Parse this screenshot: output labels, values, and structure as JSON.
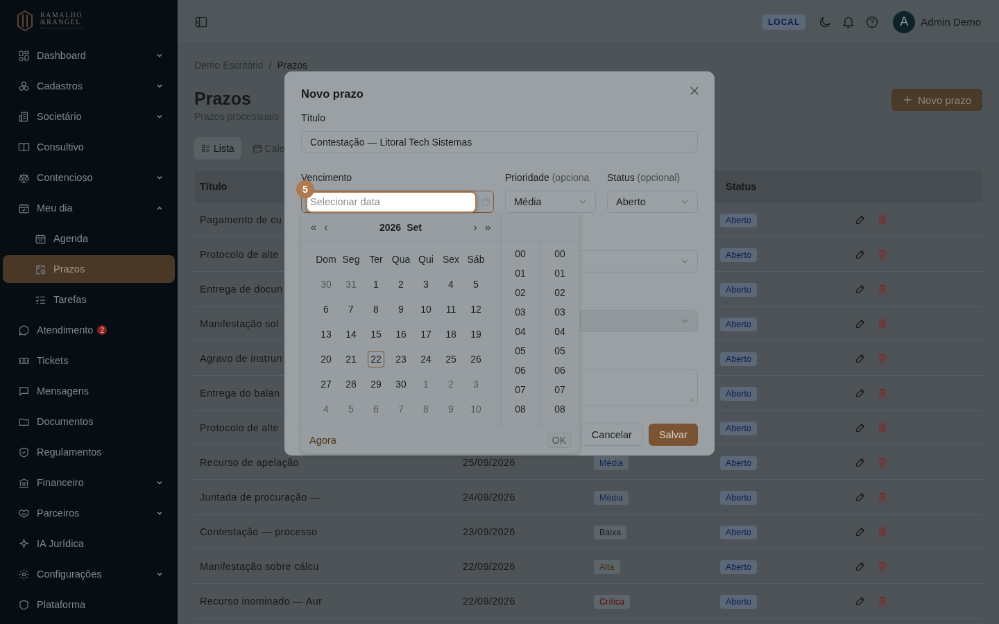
{
  "brand": {
    "line1": "RAMALHO",
    "line2": "&RANGEL"
  },
  "sidebar": {
    "items": [
      {
        "label": "Dashboard",
        "expanded": false
      },
      {
        "label": "Cadastros",
        "expanded": false
      },
      {
        "label": "Societário",
        "expanded": false
      },
      {
        "label": "Consultivo"
      },
      {
        "label": "Contencioso",
        "expanded": false
      },
      {
        "label": "Meu dia",
        "expanded": true,
        "children": [
          {
            "label": "Agenda",
            "selected": false
          },
          {
            "label": "Prazos",
            "selected": true
          },
          {
            "label": "Tarefas",
            "selected": false
          }
        ]
      },
      {
        "label": "Atendimento",
        "badge": "2"
      },
      {
        "label": "Tickets"
      },
      {
        "label": "Mensagens"
      },
      {
        "label": "Documentos"
      },
      {
        "label": "Regulamentos"
      },
      {
        "label": "Financeiro",
        "expanded": false
      },
      {
        "label": "Parceiros",
        "expanded": false
      },
      {
        "label": "IA Jurídica"
      },
      {
        "label": "Configurações",
        "expanded": false
      },
      {
        "label": "Plataforma"
      }
    ]
  },
  "topbar": {
    "environment": "LOCAL",
    "user": {
      "initial": "A",
      "name": "Admin Demo"
    }
  },
  "breadcrumb": [
    "Demo Escritório",
    "Prazos"
  ],
  "breadcrumb_separator": "/",
  "page": {
    "title": "Prazos",
    "subtitle": "Prazos processuais",
    "new_button": "Novo prazo"
  },
  "view_tabs": [
    {
      "label": "Lista",
      "selected": true
    },
    {
      "label": "Cale",
      "selected": false
    }
  ],
  "table": {
    "headers": {
      "title": "Título",
      "status": "Status"
    },
    "rows": [
      {
        "title": "Pagamento de cu",
        "status": "Aberto"
      },
      {
        "title": "Protocolo de alte",
        "status": "Aberto"
      },
      {
        "title": "Entrega de docun",
        "status": "Aberto"
      },
      {
        "title": "Manifestação sol",
        "status": "Aberto"
      },
      {
        "title": "Agravo de instrun",
        "status": "Aberto"
      },
      {
        "title": "Entrega do balan",
        "status": "Aberto"
      },
      {
        "title": "Protocolo de alte",
        "status": "Aberto"
      },
      {
        "title": "Recurso de apelação",
        "due": "25/09/2026",
        "priority": {
          "label": "Média",
          "color": "#0e2456"
        },
        "status": "Aberto"
      },
      {
        "title": "Juntada de procuração —",
        "due": "24/09/2026",
        "priority": {
          "label": "Média",
          "color": "#0e2456"
        },
        "status": "Aberto"
      },
      {
        "title": "Contestação — processo",
        "due": "23/09/2026",
        "priority": {
          "label": "Baixa",
          "color": "#1b1e20"
        },
        "status": "Aberto"
      },
      {
        "title": "Manifestação sobre cálcu",
        "due": "22/09/2026",
        "priority": {
          "label": "Alta",
          "color": "#4a2c05"
        },
        "status": "Aberto"
      },
      {
        "title": "Recurso inominado — Aur",
        "due": "22/09/2026",
        "priority": {
          "label": "Crítica",
          "color": "#5c0a0a"
        },
        "status": "Aberto"
      }
    ]
  },
  "modal": {
    "title": "Novo prazo",
    "title_label": "Título",
    "title_value": "Contestação — Litoral Tech Sistemas",
    "due_label": "Vencimento",
    "due_placeholder": "Selecionar data",
    "step": "5",
    "priority_label": "Prioridade",
    "priority_hint": "(opciona",
    "priority_value": "Média",
    "status_label": "Status",
    "status_hint": "(opcional)",
    "status_value": "Aberto",
    "cancel": "Cancelar",
    "save": "Salvar"
  },
  "datepicker": {
    "nav": [
      "«",
      "‹",
      "›",
      "»"
    ],
    "year": "2026",
    "month": "Set",
    "weekdays": [
      "Dom",
      "Seg",
      "Ter",
      "Qua",
      "Qui",
      "Sex",
      "Sáb"
    ],
    "weeks": [
      [
        {
          "d": "30",
          "muted": true,
          "today": false
        },
        {
          "d": "31",
          "muted": true,
          "today": false
        },
        {
          "d": "1",
          "muted": false,
          "today": false
        },
        {
          "d": "2",
          "muted": false,
          "today": false
        },
        {
          "d": "3",
          "muted": false,
          "today": false
        },
        {
          "d": "4",
          "muted": false,
          "today": false
        },
        {
          "d": "5",
          "muted": false,
          "today": false
        }
      ],
      [
        {
          "d": "6",
          "muted": false,
          "today": false
        },
        {
          "d": "7",
          "muted": false,
          "today": false
        },
        {
          "d": "8",
          "muted": false,
          "today": false
        },
        {
          "d": "9",
          "muted": false,
          "today": false
        },
        {
          "d": "10",
          "muted": false,
          "today": false
        },
        {
          "d": "11",
          "muted": false,
          "today": false
        },
        {
          "d": "12",
          "muted": false,
          "today": false
        }
      ],
      [
        {
          "d": "13",
          "muted": false,
          "today": false
        },
        {
          "d": "14",
          "muted": false,
          "today": false
        },
        {
          "d": "15",
          "muted": false,
          "today": false
        },
        {
          "d": "16",
          "muted": false,
          "today": false
        },
        {
          "d": "17",
          "muted": false,
          "today": false
        },
        {
          "d": "18",
          "muted": false,
          "today": false
        },
        {
          "d": "19",
          "muted": false,
          "today": false
        }
      ],
      [
        {
          "d": "20",
          "muted": false,
          "today": false
        },
        {
          "d": "21",
          "muted": false,
          "today": false
        },
        {
          "d": "22",
          "muted": false,
          "today": true
        },
        {
          "d": "23",
          "muted": false,
          "today": false
        },
        {
          "d": "24",
          "muted": false,
          "today": false
        },
        {
          "d": "25",
          "muted": false,
          "today": false
        },
        {
          "d": "26",
          "muted": false,
          "today": false
        }
      ],
      [
        {
          "d": "27",
          "muted": false,
          "today": false
        },
        {
          "d": "28",
          "muted": false,
          "today": false
        },
        {
          "d": "29",
          "muted": false,
          "today": false
        },
        {
          "d": "30",
          "muted": false,
          "today": false
        },
        {
          "d": "1",
          "muted": true,
          "today": false
        },
        {
          "d": "2",
          "muted": true,
          "today": false
        },
        {
          "d": "3",
          "muted": true,
          "today": false
        }
      ],
      [
        {
          "d": "4",
          "muted": true,
          "today": false
        },
        {
          "d": "5",
          "muted": true,
          "today": false
        },
        {
          "d": "6",
          "muted": true,
          "today": false
        },
        {
          "d": "7",
          "muted": true,
          "today": false
        },
        {
          "d": "8",
          "muted": true,
          "today": false
        },
        {
          "d": "9",
          "muted": true,
          "today": false
        },
        {
          "d": "10",
          "muted": true,
          "today": false
        }
      ]
    ],
    "hours": [
      "00",
      "01",
      "02",
      "03",
      "04",
      "05",
      "06",
      "07",
      "08"
    ],
    "minutes": [
      "00",
      "01",
      "02",
      "03",
      "04",
      "05",
      "06",
      "07",
      "08"
    ],
    "now": "Agora",
    "ok": {
      "label": "OK",
      "disabled": true
    }
  }
}
